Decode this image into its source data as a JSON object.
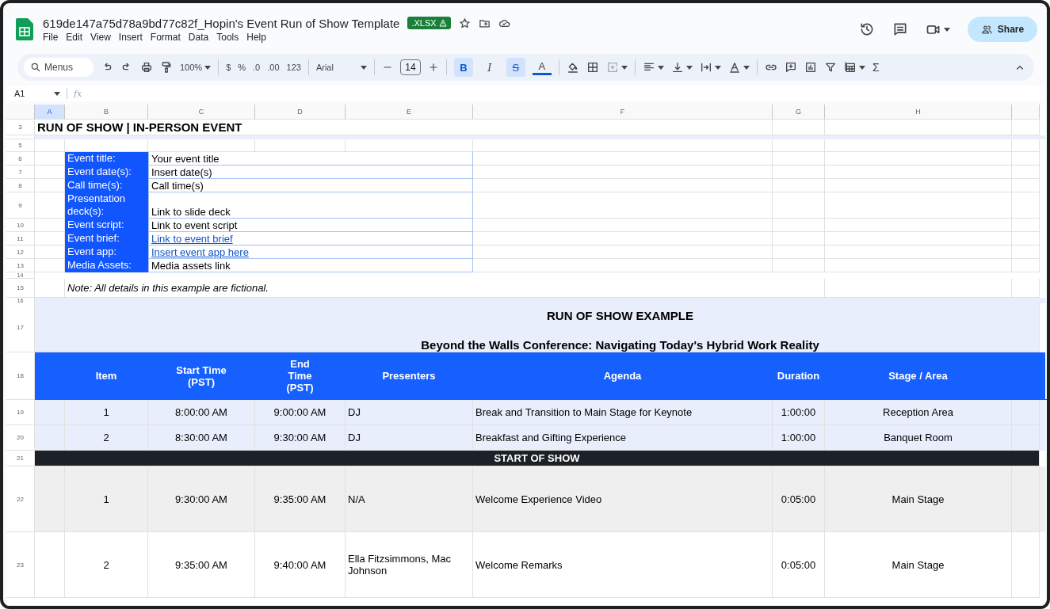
{
  "window": {
    "title": "619de147a75d78a9bd77c82f_Hopin's Event Run of Show Template",
    "file_badge": ".XLSX"
  },
  "menu": [
    "File",
    "Edit",
    "View",
    "Insert",
    "Format",
    "Data",
    "Tools",
    "Help"
  ],
  "share_button": "Share",
  "toolbar": {
    "search_placeholder": "Menus",
    "zoom": "100%",
    "currency": "$",
    "percent": "%",
    "decrease_decimals": ".0",
    "increase_decimals": ".00",
    "number_format": "123",
    "font": "Arial",
    "font_size": "14",
    "styles": [
      {
        "text": "B",
        "kind": "bold",
        "selected": true
      },
      {
        "text": "I",
        "kind": "italic",
        "selected": false
      },
      {
        "text": "S",
        "kind": "strike",
        "selected": true
      },
      {
        "text": "A",
        "kind": "color",
        "selected": false
      }
    ],
    "merge_disabled": true,
    "functions": "Σ"
  },
  "formula_bar": {
    "cell_ref": "A1",
    "fx": "fx"
  },
  "column_headers": [
    {
      "label": "A",
      "selected": true
    },
    {
      "label": "B",
      "selected": false
    },
    {
      "label": "C",
      "selected": false
    },
    {
      "label": "D",
      "selected": false
    },
    {
      "label": "E",
      "selected": false
    },
    {
      "label": "F",
      "selected": false
    },
    {
      "label": "G",
      "selected": false
    },
    {
      "label": "H",
      "selected": false
    }
  ],
  "rows": [
    {
      "kind": "title",
      "number": "3",
      "text": "RUN OF SHOW | IN-PERSON EVENT"
    },
    {
      "kind": "gap",
      "shaded": true
    },
    {
      "kind": "blank",
      "number": "5"
    },
    {
      "kind": "info",
      "number": "6",
      "label": "Event title:",
      "value": "Your event title",
      "link": false
    },
    {
      "kind": "info",
      "number": "7",
      "label": "Event date(s):",
      "value": "Insert date(s)",
      "link": false
    },
    {
      "kind": "info",
      "number": "8",
      "label": "Call time(s):",
      "value": "Call time(s)",
      "link": false
    },
    {
      "kind": "info",
      "number": "9",
      "label": "Presentation deck(s):",
      "value": "Link to slide deck",
      "link": false
    },
    {
      "kind": "info",
      "number": "10",
      "label": "Event script:",
      "value": "Link to event script",
      "link": false
    },
    {
      "kind": "info",
      "number": "11",
      "label": "Event brief:",
      "value": "Link to event brief",
      "link": true
    },
    {
      "kind": "info",
      "number": "12",
      "label": "Event app:",
      "value": "Insert event app here",
      "link": true
    },
    {
      "kind": "info",
      "number": "13",
      "label": "Media Assets:",
      "value": "Media assets link",
      "link": false
    },
    {
      "kind": "gap",
      "number": "14",
      "shaded": false
    },
    {
      "kind": "note",
      "number": "15",
      "text": "Note: All details in this example are fictional."
    },
    {
      "kind": "gap",
      "number": "16",
      "shaded": true
    },
    {
      "kind": "banner",
      "number": "17",
      "title": "RUN OF SHOW EXAMPLE",
      "subtitle": "Beyond the Walls Conference: Navigating Today's Hybrid Work Reality"
    },
    {
      "kind": "header",
      "number": "18",
      "cells": [
        "Item",
        "Start Time (PST)",
        "End Time (PST)",
        "Presenters",
        "Agenda",
        "Duration",
        "Stage / Area"
      ]
    },
    {
      "kind": "pre_entry",
      "number": "19",
      "cells": [
        "1",
        "8:00:00 AM",
        "9:00:00 AM",
        "DJ",
        "Break and Transition to Main Stage for Keynote",
        "1:00:00",
        "Reception Area"
      ]
    },
    {
      "kind": "pre_entry",
      "number": "20",
      "cells": [
        "2",
        "8:30:00 AM",
        "9:30:00 AM",
        "DJ",
        "Breakfast and Gifting Experience",
        "1:00:00",
        "Banquet Room"
      ]
    },
    {
      "kind": "section",
      "number": "21",
      "text": "START OF SHOW"
    },
    {
      "kind": "entry",
      "number": "22",
      "shaded": true,
      "cells": [
        "1",
        "9:30:00 AM",
        "9:35:00 AM",
        "N/A",
        "Welcome Experience Video",
        "0:05:00",
        "Main Stage"
      ]
    },
    {
      "kind": "entry",
      "number": "23",
      "shaded": false,
      "cells": [
        "2",
        "9:35:00 AM",
        "9:40:00 AM",
        "Ella Fitzsimmons, Mac Johnson",
        "Welcome Remarks",
        "0:05:00",
        "Main Stage"
      ]
    }
  ]
}
